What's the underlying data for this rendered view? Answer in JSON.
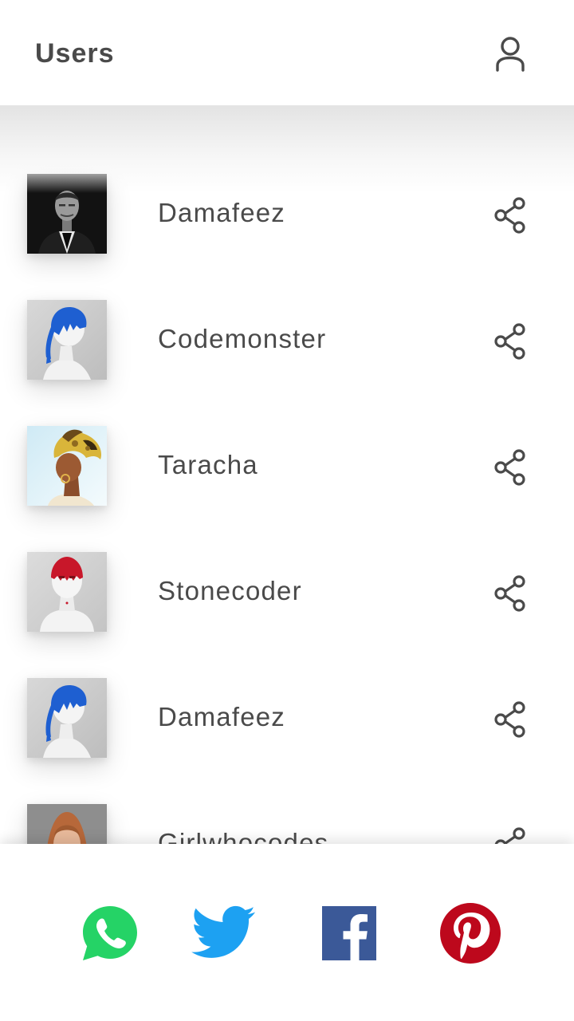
{
  "header": {
    "title": "Users",
    "profile_icon": "user-outline-icon"
  },
  "users": [
    {
      "name": "Damafeez",
      "avatar": "man-portrait-bw",
      "action_icon": "share-icon"
    },
    {
      "name": "Codemonster",
      "avatar": "blue-paint-head",
      "action_icon": "share-icon"
    },
    {
      "name": "Taracha",
      "avatar": "woman-headwrap",
      "action_icon": "share-icon"
    },
    {
      "name": "Stonecoder",
      "avatar": "red-paint-head",
      "action_icon": "share-icon"
    },
    {
      "name": "Damafeez",
      "avatar": "blue-paint-head",
      "action_icon": "share-icon"
    },
    {
      "name": "Girlwhocodes",
      "avatar": "woman-portrait",
      "action_icon": "share-icon"
    }
  ],
  "share_bar": {
    "items": [
      {
        "name": "whatsapp",
        "icon": "whatsapp-icon",
        "color": "#25D366"
      },
      {
        "name": "twitter",
        "icon": "twitter-icon",
        "color": "#1DA1F2"
      },
      {
        "name": "facebook",
        "icon": "facebook-icon",
        "color": "#3B5998"
      },
      {
        "name": "pinterest",
        "icon": "pinterest-icon",
        "color": "#BD081C"
      }
    ]
  },
  "colors": {
    "text": "#4a4a4a",
    "icon": "#4a4a4a",
    "background": "#ffffff"
  }
}
